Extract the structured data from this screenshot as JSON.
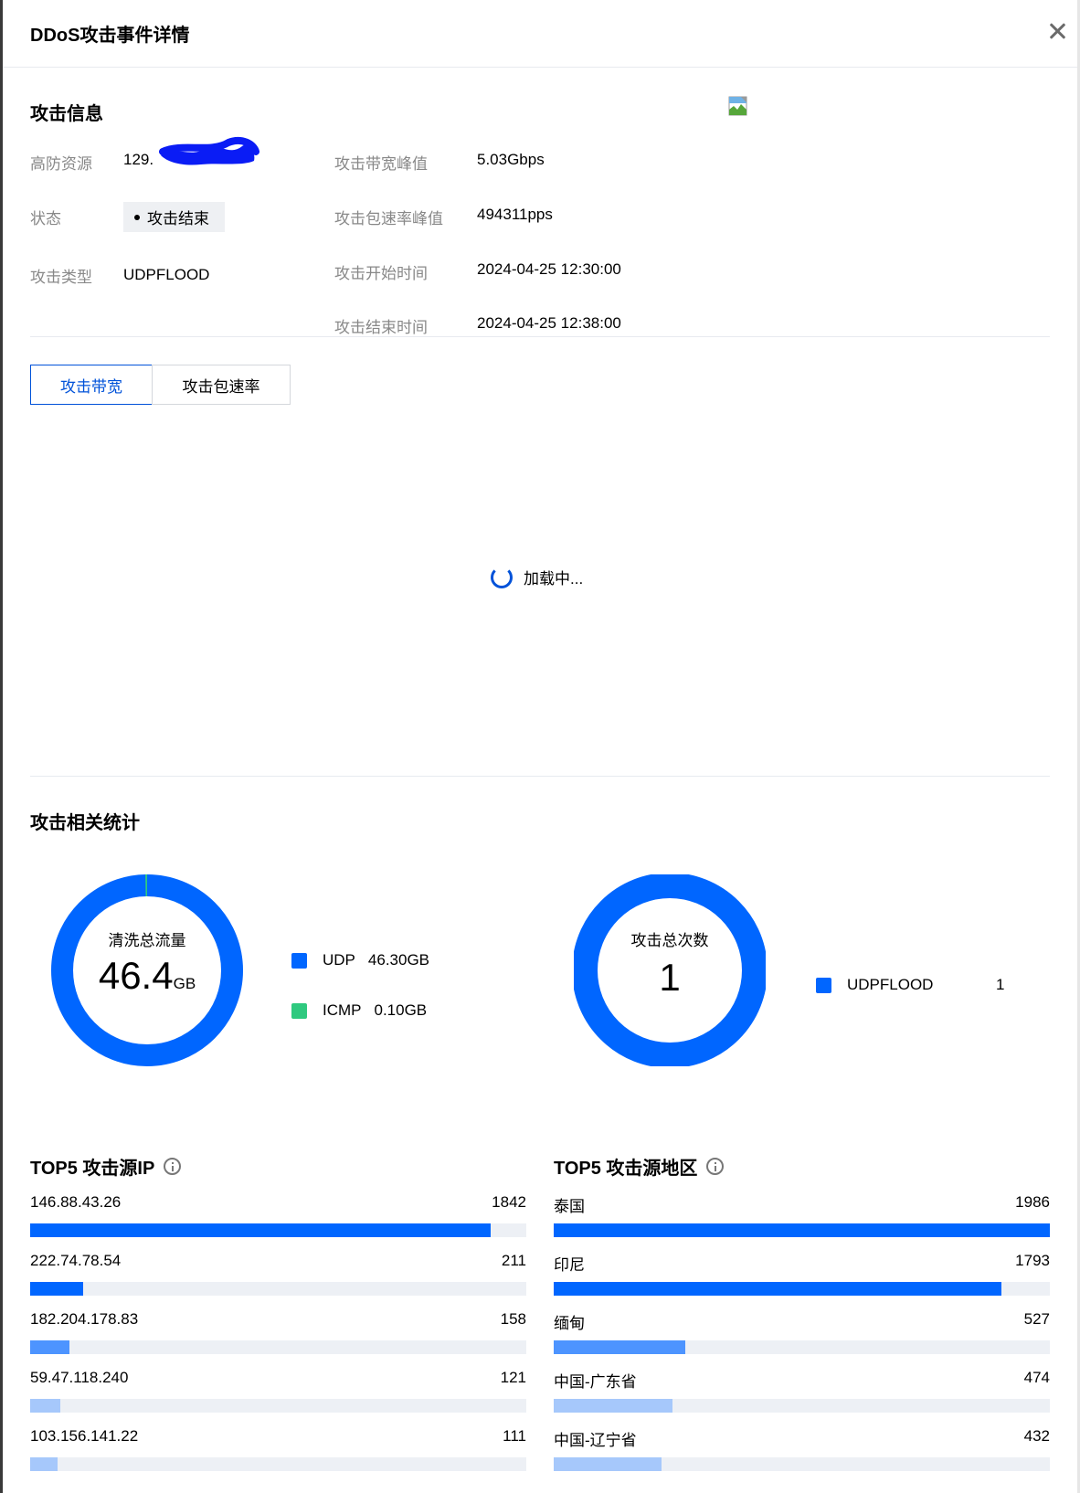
{
  "dialog": {
    "title": "DDoS攻击事件详情"
  },
  "attack_info": {
    "section_title": "攻击信息",
    "resource_label": "高防资源",
    "resource_value": "129.",
    "status_label": "状态",
    "status_value": "攻击结束",
    "type_label": "攻击类型",
    "type_value": "UDPFLOOD",
    "bw_peak_label": "攻击带宽峰值",
    "bw_peak_value": "5.03Gbps",
    "pps_peak_label": "攻击包速率峰值",
    "pps_peak_value": "494311pps",
    "start_label": "攻击开始时间",
    "start_value": "2024-04-25 12:30:00",
    "end_label": "攻击结束时间",
    "end_value": "2024-04-25 12:38:00"
  },
  "tabs": [
    {
      "label": "攻击带宽",
      "active": true
    },
    {
      "label": "攻击包速率",
      "active": false
    }
  ],
  "loading": {
    "text": "加载中..."
  },
  "stats": {
    "section_title": "攻击相关统计",
    "colors": {
      "udp": "#0066ff",
      "icmp": "#2fc97f",
      "track": "#edf0f5"
    },
    "traffic": {
      "center_label": "清洗总流量",
      "big_value": "46.4",
      "unit": "GB",
      "legend": [
        {
          "name": "UDP",
          "value": "46.30GB",
          "raw": 46.3,
          "color": "#0066ff"
        },
        {
          "name": "ICMP",
          "value": "0.10GB",
          "raw": 0.1,
          "color": "#2fc97f"
        }
      ]
    },
    "count": {
      "center_label": "攻击总次数",
      "big_value": "1",
      "legend": [
        {
          "name": "UDPFLOOD",
          "value": "1",
          "raw": 1,
          "color": "#0066ff"
        }
      ]
    }
  },
  "top_ip": {
    "title": "TOP5 攻击源IP",
    "items": [
      {
        "name": "146.88.43.26",
        "count": "1842",
        "value": 1842,
        "color": "#0066ff"
      },
      {
        "name": "222.74.78.54",
        "count": "211",
        "value": 211,
        "color": "#0066ff"
      },
      {
        "name": "182.204.178.83",
        "count": "158",
        "value": 158,
        "color": "#4d94ff"
      },
      {
        "name": "59.47.118.240",
        "count": "121",
        "value": 121,
        "color": "#a6c8fb"
      },
      {
        "name": "103.156.141.22",
        "count": "111",
        "value": 111,
        "color": "#a6c8fb"
      }
    ]
  },
  "top_region": {
    "title": "TOP5 攻击源地区",
    "items": [
      {
        "name": "泰国",
        "count": "1986",
        "value": 1986,
        "color": "#0066ff"
      },
      {
        "name": "印尼",
        "count": "1793",
        "value": 1793,
        "color": "#0066ff"
      },
      {
        "name": "缅甸",
        "count": "527",
        "value": 527,
        "color": "#4d94ff"
      },
      {
        "name": "中国-广东省",
        "count": "474",
        "value": 474,
        "color": "#a6c8fb"
      },
      {
        "name": "中国-辽宁省",
        "count": "432",
        "value": 432,
        "color": "#a6c8fb"
      }
    ]
  }
}
